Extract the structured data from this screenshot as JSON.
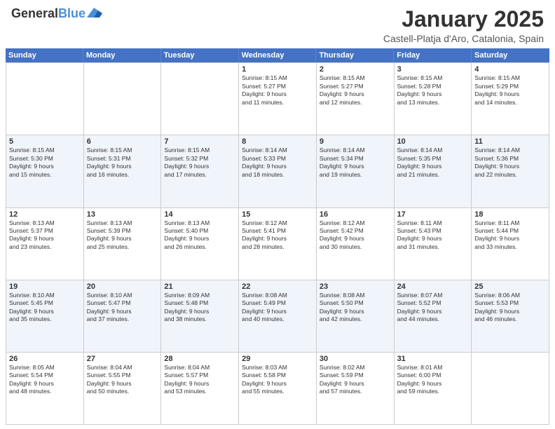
{
  "header": {
    "logo_line1": "General",
    "logo_line2": "Blue",
    "month": "January 2025",
    "location": "Castell-Platja d'Aro, Catalonia, Spain"
  },
  "weekdays": [
    "Sunday",
    "Monday",
    "Tuesday",
    "Wednesday",
    "Thursday",
    "Friday",
    "Saturday"
  ],
  "rows": [
    [
      {
        "day": "",
        "info": ""
      },
      {
        "day": "",
        "info": ""
      },
      {
        "day": "",
        "info": ""
      },
      {
        "day": "1",
        "info": "Sunrise: 8:15 AM\nSunset: 5:27 PM\nDaylight: 9 hours\nand 11 minutes."
      },
      {
        "day": "2",
        "info": "Sunrise: 8:15 AM\nSunset: 5:27 PM\nDaylight: 9 hours\nand 12 minutes."
      },
      {
        "day": "3",
        "info": "Sunrise: 8:15 AM\nSunset: 5:28 PM\nDaylight: 9 hours\nand 13 minutes."
      },
      {
        "day": "4",
        "info": "Sunrise: 8:15 AM\nSunset: 5:29 PM\nDaylight: 9 hours\nand 14 minutes."
      }
    ],
    [
      {
        "day": "5",
        "info": "Sunrise: 8:15 AM\nSunset: 5:30 PM\nDaylight: 9 hours\nand 15 minutes."
      },
      {
        "day": "6",
        "info": "Sunrise: 8:15 AM\nSunset: 5:31 PM\nDaylight: 9 hours\nand 16 minutes."
      },
      {
        "day": "7",
        "info": "Sunrise: 8:15 AM\nSunset: 5:32 PM\nDaylight: 9 hours\nand 17 minutes."
      },
      {
        "day": "8",
        "info": "Sunrise: 8:14 AM\nSunset: 5:33 PM\nDaylight: 9 hours\nand 18 minutes."
      },
      {
        "day": "9",
        "info": "Sunrise: 8:14 AM\nSunset: 5:34 PM\nDaylight: 9 hours\nand 19 minutes."
      },
      {
        "day": "10",
        "info": "Sunrise: 8:14 AM\nSunset: 5:35 PM\nDaylight: 9 hours\nand 21 minutes."
      },
      {
        "day": "11",
        "info": "Sunrise: 8:14 AM\nSunset: 5:36 PM\nDaylight: 9 hours\nand 22 minutes."
      }
    ],
    [
      {
        "day": "12",
        "info": "Sunrise: 8:13 AM\nSunset: 5:37 PM\nDaylight: 9 hours\nand 23 minutes."
      },
      {
        "day": "13",
        "info": "Sunrise: 8:13 AM\nSunset: 5:39 PM\nDaylight: 9 hours\nand 25 minutes."
      },
      {
        "day": "14",
        "info": "Sunrise: 8:13 AM\nSunset: 5:40 PM\nDaylight: 9 hours\nand 26 minutes."
      },
      {
        "day": "15",
        "info": "Sunrise: 8:12 AM\nSunset: 5:41 PM\nDaylight: 9 hours\nand 28 minutes."
      },
      {
        "day": "16",
        "info": "Sunrise: 8:12 AM\nSunset: 5:42 PM\nDaylight: 9 hours\nand 30 minutes."
      },
      {
        "day": "17",
        "info": "Sunrise: 8:11 AM\nSunset: 5:43 PM\nDaylight: 9 hours\nand 31 minutes."
      },
      {
        "day": "18",
        "info": "Sunrise: 8:11 AM\nSunset: 5:44 PM\nDaylight: 9 hours\nand 33 minutes."
      }
    ],
    [
      {
        "day": "19",
        "info": "Sunrise: 8:10 AM\nSunset: 5:45 PM\nDaylight: 9 hours\nand 35 minutes."
      },
      {
        "day": "20",
        "info": "Sunrise: 8:10 AM\nSunset: 5:47 PM\nDaylight: 9 hours\nand 37 minutes."
      },
      {
        "day": "21",
        "info": "Sunrise: 8:09 AM\nSunset: 5:48 PM\nDaylight: 9 hours\nand 38 minutes."
      },
      {
        "day": "22",
        "info": "Sunrise: 8:08 AM\nSunset: 5:49 PM\nDaylight: 9 hours\nand 40 minutes."
      },
      {
        "day": "23",
        "info": "Sunrise: 8:08 AM\nSunset: 5:50 PM\nDaylight: 9 hours\nand 42 minutes."
      },
      {
        "day": "24",
        "info": "Sunrise: 8:07 AM\nSunset: 5:52 PM\nDaylight: 9 hours\nand 44 minutes."
      },
      {
        "day": "25",
        "info": "Sunrise: 8:06 AM\nSunset: 5:53 PM\nDaylight: 9 hours\nand 46 minutes."
      }
    ],
    [
      {
        "day": "26",
        "info": "Sunrise: 8:05 AM\nSunset: 5:54 PM\nDaylight: 9 hours\nand 48 minutes."
      },
      {
        "day": "27",
        "info": "Sunrise: 8:04 AM\nSunset: 5:55 PM\nDaylight: 9 hours\nand 50 minutes."
      },
      {
        "day": "28",
        "info": "Sunrise: 8:04 AM\nSunset: 5:57 PM\nDaylight: 9 hours\nand 53 minutes."
      },
      {
        "day": "29",
        "info": "Sunrise: 8:03 AM\nSunset: 5:58 PM\nDaylight: 9 hours\nand 55 minutes."
      },
      {
        "day": "30",
        "info": "Sunrise: 8:02 AM\nSunset: 5:59 PM\nDaylight: 9 hours\nand 57 minutes."
      },
      {
        "day": "31",
        "info": "Sunrise: 8:01 AM\nSunset: 6:00 PM\nDaylight: 9 hours\nand 59 minutes."
      },
      {
        "day": "",
        "info": ""
      }
    ]
  ]
}
